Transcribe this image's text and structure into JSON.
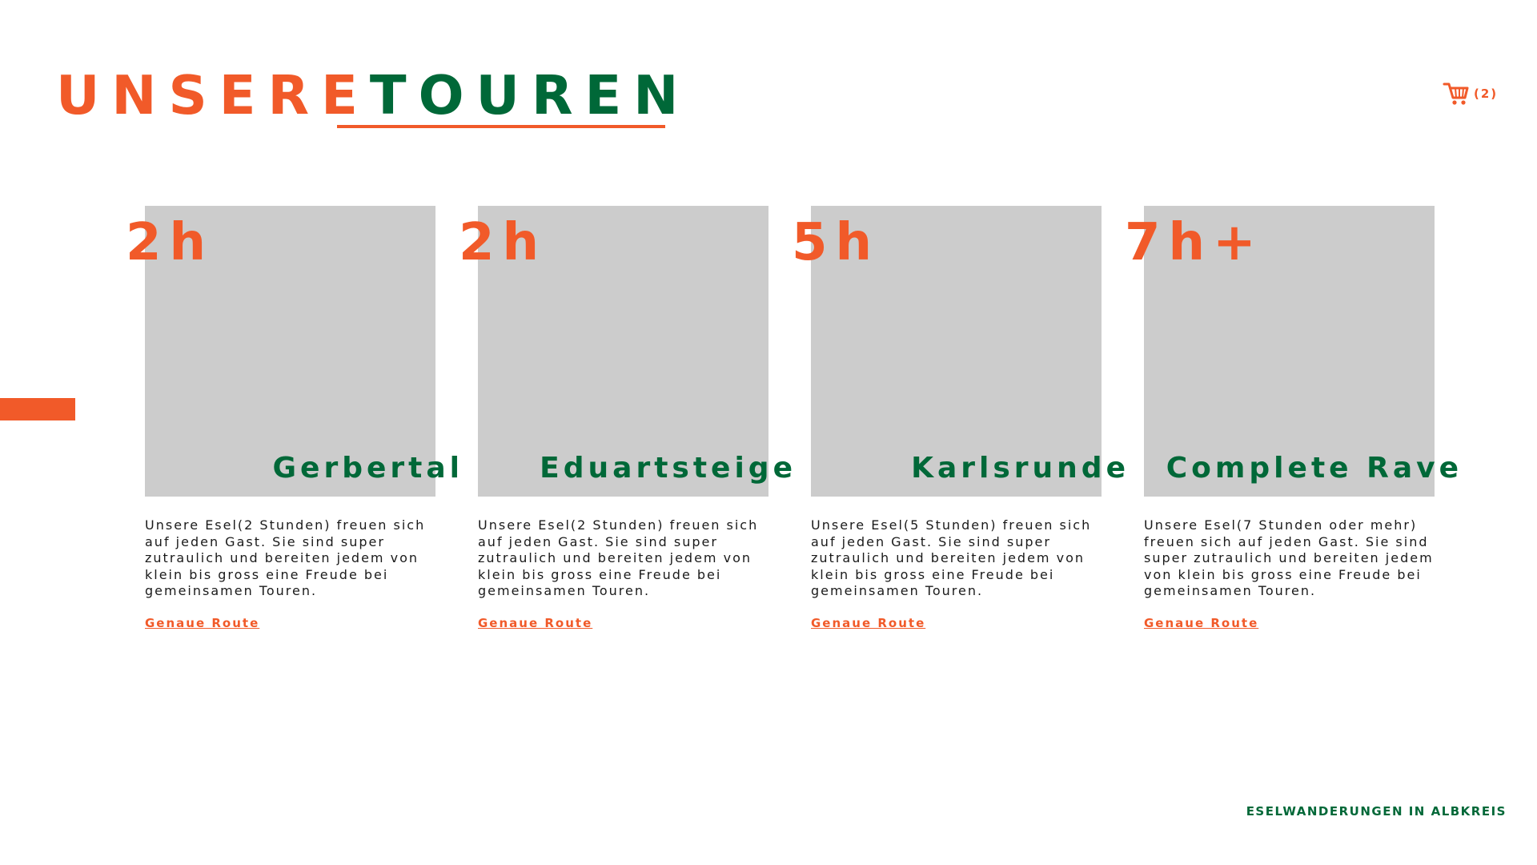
{
  "header": {
    "title_part1": "UNSERE",
    "title_part2": "TOUREN"
  },
  "cart": {
    "icon": "shopping-cart-icon",
    "count_label": "(2)"
  },
  "tours": [
    {
      "duration": "2h",
      "name": "Gerbertal",
      "description": "Unsere Esel(2 Stunden) freuen sich auf jeden Gast. Sie sind super zutraulich und bereiten jedem von klein bis gross eine Freude bei gemeinsamen Touren.",
      "link_label": "Genaue Route"
    },
    {
      "duration": "2h",
      "name": "Eduartsteige",
      "description": "Unsere Esel(2 Stunden) freuen sich auf jeden Gast. Sie sind super zutraulich und bereiten jedem von klein bis gross eine Freude bei gemeinsamen Touren.",
      "link_label": "Genaue Route"
    },
    {
      "duration": "5h",
      "name": "Karlsrunde",
      "description": "Unsere Esel(5 Stunden) freuen sich auf jeden Gast. Sie sind super zutraulich und bereiten jedem von klein bis gross eine Freude bei gemeinsamen Touren.",
      "link_label": "Genaue Route"
    },
    {
      "duration": "7h+",
      "name": "Complete Rave",
      "description": "Unsere Esel(7 Stunden oder mehr) freuen sich auf jeden Gast. Sie sind super zutraulich und bereiten jedem von klein bis gross eine Freude bei gemeinsamen Touren.",
      "link_label": "Genaue Route"
    }
  ],
  "footer": {
    "text": "ESELWANDERUNGEN IN ALBKREIS"
  },
  "colors": {
    "accent_orange": "#F15A29",
    "brand_green": "#006838",
    "placeholder_gray": "#CCCCCC"
  }
}
